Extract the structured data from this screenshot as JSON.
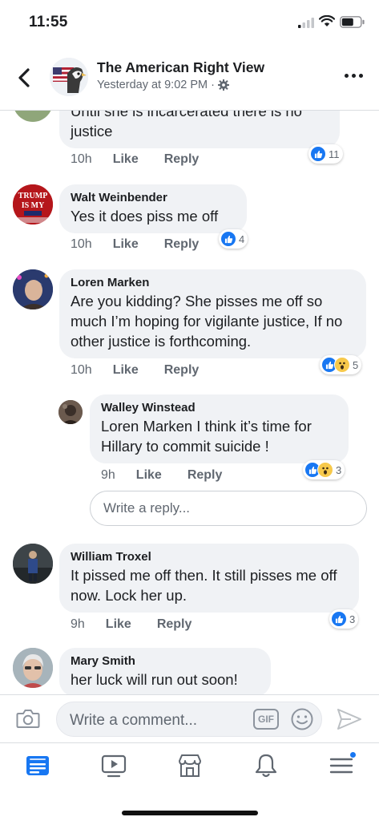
{
  "status_bar": {
    "time": "11:55"
  },
  "header": {
    "page_name": "The American Right View",
    "timestamp": "Yesterday at 9:02 PM",
    "separator": "·"
  },
  "comments": [
    {
      "author": "",
      "text": "Until she is incarcerated there is no justice",
      "age": "10h",
      "like_label": "Like",
      "reply_label": "Reply",
      "reaction_count": "11"
    },
    {
      "author": "Walt Weinbender",
      "text": "Yes it does piss me off",
      "age": "10h",
      "like_label": "Like",
      "reply_label": "Reply",
      "reaction_count": "4",
      "avatar_text": "TRUMP IS MY"
    },
    {
      "author": "Loren Marken",
      "text": "Are you kidding? She pisses me off so much I’m hoping for vigilante justice, If no other justice is forthcoming.",
      "age": "10h",
      "like_label": "Like",
      "reply_label": "Reply",
      "reaction_count": "5"
    },
    {
      "author": "Walley Winstead",
      "text": "Loren Marken I think it’s time for Hillary to commit suicide !",
      "age": "9h",
      "like_label": "Like",
      "reply_label": "Reply",
      "reaction_count": "3"
    },
    {
      "author": "William Troxel",
      "text": "It pissed me off then. It still pisses me off now. Lock her up.",
      "age": "9h",
      "like_label": "Like",
      "reply_label": "Reply",
      "reaction_count": "3"
    },
    {
      "author": "Mary Smith",
      "text": "her luck will run out soon!"
    }
  ],
  "reply_box": {
    "placeholder": "Write a reply..."
  },
  "composer": {
    "placeholder": "Write a comment...",
    "gif_label": "GIF"
  },
  "colors": {
    "accent": "#1877f2",
    "bubble": "#f0f2f5",
    "meta": "#606770"
  },
  "tabs": [
    "news-feed-icon",
    "watch-icon",
    "marketplace-icon",
    "notifications-icon",
    "menu-icon"
  ]
}
